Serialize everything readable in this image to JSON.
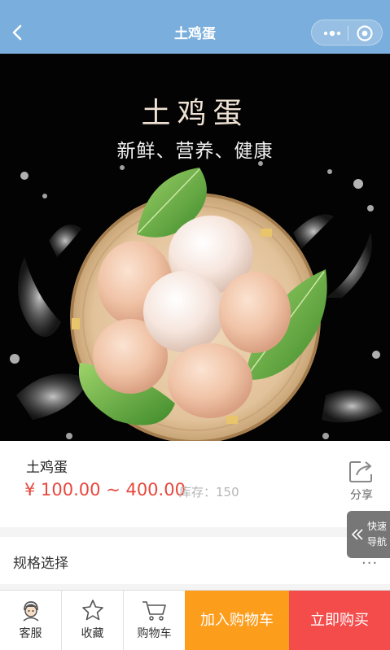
{
  "header": {
    "title": "土鸡蛋",
    "back_icon": "chevron-left-icon",
    "more_icon": "more-dots-icon",
    "close_icon": "target-close-icon",
    "background_color": "#7aaedc"
  },
  "banner": {
    "title": "土鸡蛋",
    "subtitle": "新鲜、营养、健康"
  },
  "product": {
    "name": "土鸡蛋",
    "price": "¥ 100.00 ~ 400.00",
    "stock_label": "库存：",
    "stock_value": "150",
    "share_label": "分享",
    "price_color": "#e8473c"
  },
  "spec": {
    "label": "规格选择",
    "more": "···"
  },
  "quick_nav": {
    "line1": "快速",
    "line2": "导航"
  },
  "bottom_bar": {
    "service_label": "客服",
    "favorite_label": "收藏",
    "cart_label": "购物车",
    "add_to_cart": "加入购物车",
    "buy_now": "立即购买",
    "add_to_cart_color": "#fc9d1c",
    "buy_now_color": "#f44b4b"
  }
}
